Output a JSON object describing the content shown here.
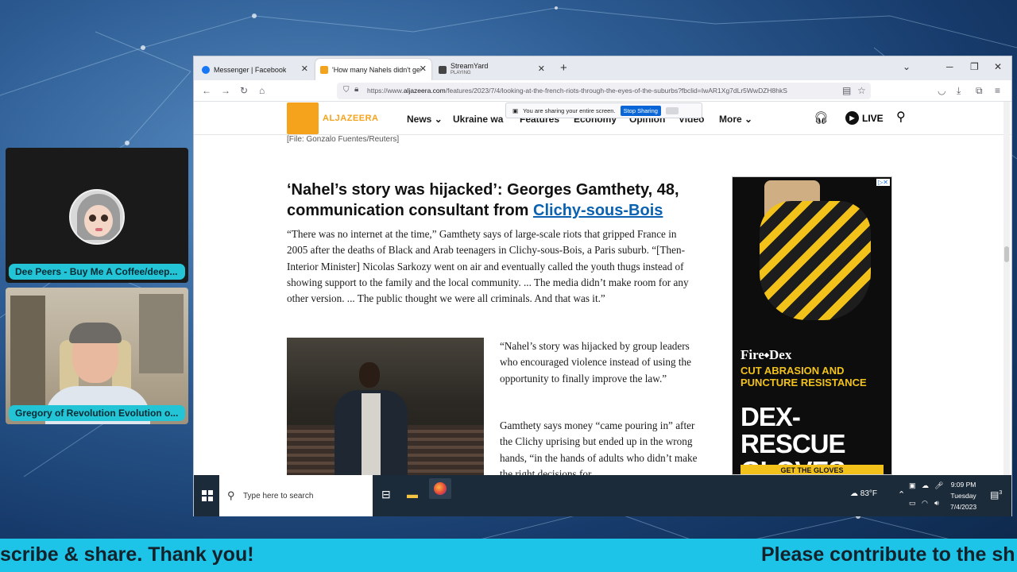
{
  "stream": {
    "participants": [
      {
        "name": "Dee Peers - Buy Me A Coffee/deep..."
      },
      {
        "name": "Gregory of Revolution Evolution o..."
      }
    ],
    "ticker": {
      "left_text": "scribe & share. Thank you!",
      "right_text": "Please contribute to the sh"
    }
  },
  "browser": {
    "tabs": [
      {
        "title": "Messenger | Facebook",
        "favicon_color": "#1877f2"
      },
      {
        "title": "'How many Nahels didn't get fi",
        "favicon_color": "#f5a21c"
      },
      {
        "title": "StreamYard",
        "subtitle": "PLAYING",
        "favicon_color": "#444444"
      }
    ],
    "new_tab_glyph": "+",
    "url_prefix": "https://www.",
    "url_domain": "aljazeera.com",
    "url_path": "/features/2023/7/4/looking-at-the-french-riots-through-the-eyes-of-the-suburbs?fbclid=IwAR1Xg7dLr5WwDZH8hkS",
    "sharing_bar": {
      "text": "You are sharing your entire screen.",
      "stop_label": "Stop Sharing"
    }
  },
  "site": {
    "logo_text": "ALJAZEERA",
    "nav": [
      "News",
      "Ukraine war",
      "Features",
      "Economy",
      "Opinion",
      "Video",
      "More"
    ],
    "live_label": "LIVE",
    "accent": "#f5a21c"
  },
  "article": {
    "photo_caption": "[File: Gonzalo Fuentes/Reuters]",
    "heading_main": "‘Nahel’s story was hijacked’: Georges Gamthety, 48, communication consultant from ",
    "heading_link": "Clichy-sous-Bois",
    "para1": "“There was no internet at the time,” Gamthety says of large-scale riots that gripped France in 2005 after the deaths of Black and Arab teenagers in Clichy-sous-Bois, a Paris suburb. “[Then-Interior Minister] Nicolas Sarkozy went on air and eventually called the youth thugs instead of showing support to the family and the local community. ... The media didn’t make room for any other version. ... The public thought we were all criminals. And that was it.”",
    "para2": "“Nahel’s story was hijacked by group leaders who encouraged violence instead of using the opportunity to finally improve the law.”",
    "para3": "Gamthety says money “came pouring in” after the Clichy uprising but ended up in the wrong hands, “in the hands of adults who didn’t make the right decisions for"
  },
  "ad": {
    "brand": "Fire⬩Dex",
    "tagline": "CUT ABRASION AND PUNCTURE RESISTANCE",
    "product": "DEX-RESCUE GLOVES",
    "cta": "GET THE GLOVES"
  },
  "taskbar": {
    "search_placeholder": "Type here to search",
    "temperature": "83°F",
    "time": "9:09 PM",
    "day": "Tuesday",
    "date": "7/4/2023",
    "notification_count": "3"
  }
}
